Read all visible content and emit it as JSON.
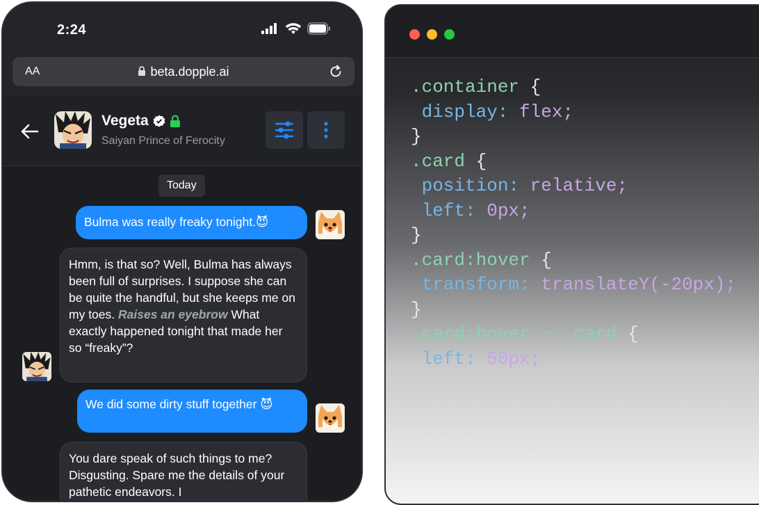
{
  "status_bar": {
    "time": "2:24"
  },
  "browser": {
    "text_size": "AA",
    "url": "beta.dopple.ai"
  },
  "chat_header": {
    "name": "Vegeta",
    "subtitle": "Saiyan Prince of Ferocity"
  },
  "chat": {
    "date_label": "Today",
    "messages": [
      {
        "from": "user",
        "text": "Bulma was really freaky tonight.😈"
      },
      {
        "from": "bot",
        "text_before": "Hmm, is that so? Well, Bulma has always been full of surprises. I suppose she can be quite the handful, but she keeps me on my toes. ",
        "action": "Raises an eyebrow",
        "text_after": " What exactly happened tonight that made her so “freaky”?"
      },
      {
        "from": "user",
        "text": "We did some dirty stuff together 😈"
      },
      {
        "from": "bot",
        "text": "You dare speak of such things to me? Disgusting. Spare me the details of your pathetic endeavors. I"
      }
    ]
  },
  "code_editor": {
    "lines": [
      ".container {",
      " display: flex;",
      "}",
      ".card {",
      " position: relative;",
      " left: 0px;",
      "}",
      ".card:hover {",
      " transform: translateY(-20px);",
      "}",
      ".card:hover ~ .card {",
      " left: 50px;"
    ]
  },
  "colors": {
    "user_bubble": "#1e8bff",
    "verified_badge": "#ffffff",
    "lock": "#2ecc55",
    "header_button_icon": "#1e8bff",
    "traffic_red": "#ff5f57",
    "traffic_yellow": "#febc2e",
    "traffic_green": "#28c840"
  }
}
